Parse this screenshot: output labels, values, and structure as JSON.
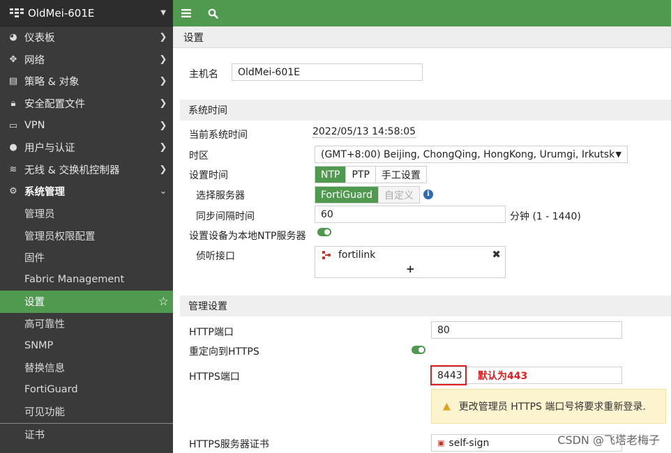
{
  "sidebar": {
    "device_name": "OldMei-601E",
    "items": [
      {
        "label": "仪表板"
      },
      {
        "label": "网络"
      },
      {
        "label": "策略 & 对象"
      },
      {
        "label": "安全配置文件"
      },
      {
        "label": "VPN"
      },
      {
        "label": "用户与认证"
      },
      {
        "label": "无线 & 交换机控制器"
      },
      {
        "label": "系统管理"
      }
    ],
    "subitems": [
      {
        "label": "管理员"
      },
      {
        "label": "管理员权限配置"
      },
      {
        "label": "固件"
      },
      {
        "label": "Fabric Management"
      },
      {
        "label": "设置"
      },
      {
        "label": "高可靠性"
      },
      {
        "label": "SNMP"
      },
      {
        "label": "替换信息"
      },
      {
        "label": "FortiGuard"
      },
      {
        "label": "可见功能"
      },
      {
        "label": "证书"
      }
    ]
  },
  "page": {
    "title": "设置"
  },
  "form": {
    "hostname_label": "主机名",
    "hostname_value": "OldMei-601E",
    "system_time_section": "系统时间",
    "current_time_label": "当前系统时间",
    "current_time_value": "2022/05/13 14:58:05",
    "timezone_label": "时区",
    "timezone_value": "(GMT+8:00) Beijing, ChongQing, HongKong, Urumgi, Irkutsk",
    "set_time_label": "设置时间",
    "set_time_options": [
      "NTP",
      "PTP",
      "手工设置"
    ],
    "select_server_label": "选择服务器",
    "server_options": [
      "FortiGuard",
      "自定义"
    ],
    "sync_interval_label": "同步间隔时间",
    "sync_interval_value": "60",
    "sync_interval_unit": "分钟 (1 - 1440)",
    "local_ntp_label": "设置设备为本地NTP服务器",
    "listen_iface_label": "侦听接口",
    "listen_iface_value": "fortilink",
    "add_symbol": "+",
    "admin_section": "管理设置",
    "http_port_label": "HTTP端口",
    "http_port_value": "80",
    "redirect_https_label": "重定向到HTTPS",
    "https_port_label": "HTTPS端口",
    "https_port_value": "8443",
    "https_annotation": "默认为443",
    "warning_text": "更改管理员 HTTPS 端口号将要求重新登录.",
    "https_cert_label": "HTTPS服务器证书",
    "https_cert_value": "self-sign"
  },
  "watermark": "CSDN @飞塔老梅子",
  "colors": {
    "accent": "#4f9a4f",
    "sidebar_bg": "#3a3a3a",
    "annotation": "#e02020"
  }
}
